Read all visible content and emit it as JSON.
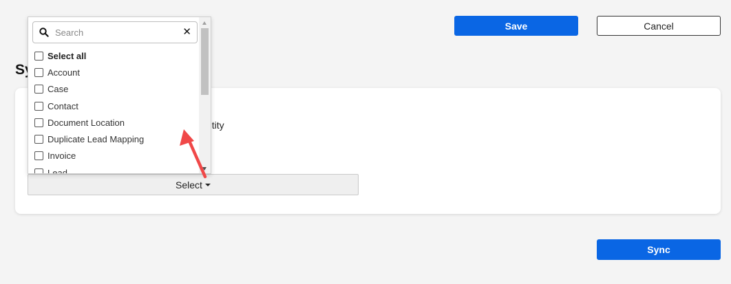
{
  "header": {
    "save_label": "Save",
    "cancel_label": "Cancel"
  },
  "section": {
    "title_visible": "Sy",
    "label_visible_fragment": "ntity"
  },
  "select_button": {
    "label": "Select"
  },
  "dropdown": {
    "search_placeholder": "Search",
    "search_value": "",
    "options": [
      {
        "label": "Select all",
        "checked": false
      },
      {
        "label": "Account",
        "checked": false
      },
      {
        "label": "Case",
        "checked": false
      },
      {
        "label": "Contact",
        "checked": false
      },
      {
        "label": "Document Location",
        "checked": false
      },
      {
        "label": "Duplicate Lead Mapping",
        "checked": false
      },
      {
        "label": "Invoice",
        "checked": false
      },
      {
        "label": "Lead",
        "checked": false
      }
    ]
  },
  "footer": {
    "sync_label": "Sync"
  },
  "colors": {
    "primary": "#0a66e4",
    "page_bg": "#f4f4f4",
    "annotation": "#f04848"
  }
}
